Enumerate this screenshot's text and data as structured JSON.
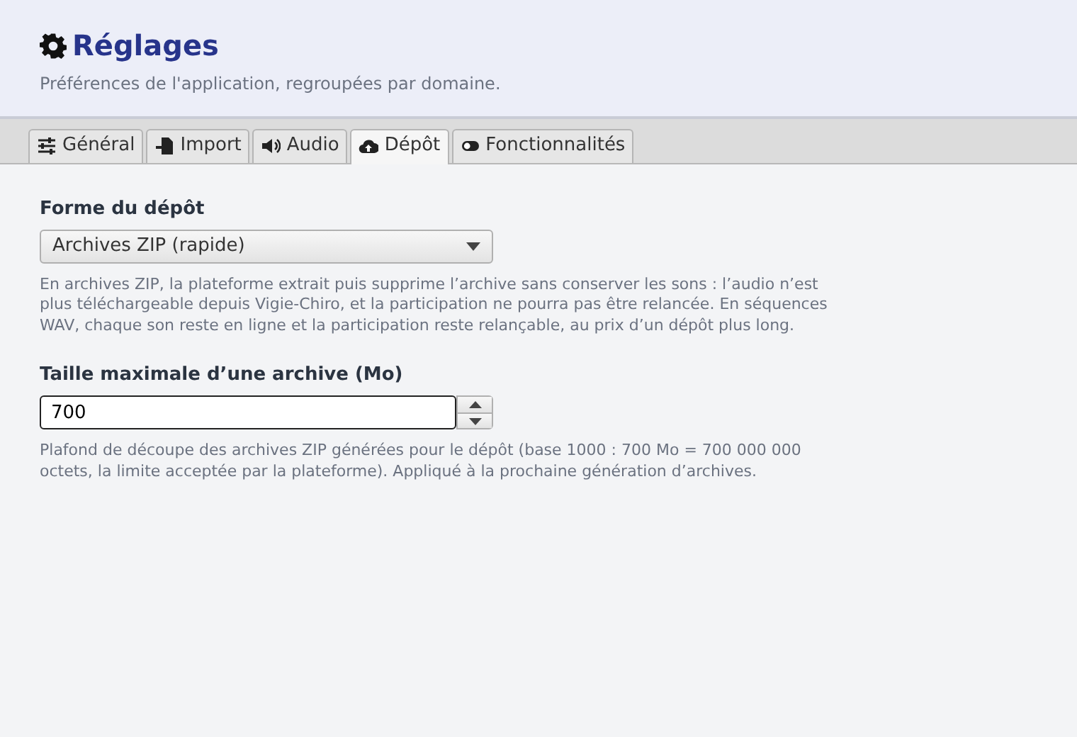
{
  "header": {
    "title": "Réglages",
    "subtitle": "Préférences de l'application, regroupées par domaine."
  },
  "tabs": [
    {
      "label": "Général",
      "selected": false
    },
    {
      "label": "Import",
      "selected": false
    },
    {
      "label": "Audio",
      "selected": false
    },
    {
      "label": "Dépôt",
      "selected": true
    },
    {
      "label": "Fonctionnalités",
      "selected": false
    }
  ],
  "fields": [
    {
      "kind": "select",
      "label": "Forme du dépôt",
      "value": "Archives ZIP (rapide)",
      "help": "En archives ZIP, la plateforme extrait puis supprime l’archive sans conserver les sons : l’audio n’est plus téléchargeable depuis Vigie-Chiro, et la participation ne pourra pas être relancée. En séquences WAV, chaque son reste en ligne et la participation reste relançable, au prix d’un dépôt plus long."
    },
    {
      "kind": "spin",
      "label": "Taille maximale d’une archive (Mo)",
      "value": "700",
      "help": "Plafond de découpe des archives ZIP générées pour le dépôt (base 1000 : 700 Mo = 700 000 000 octets, la limite acceptée par la plateforme). Appliqué à la prochaine génération d’archives."
    }
  ]
}
